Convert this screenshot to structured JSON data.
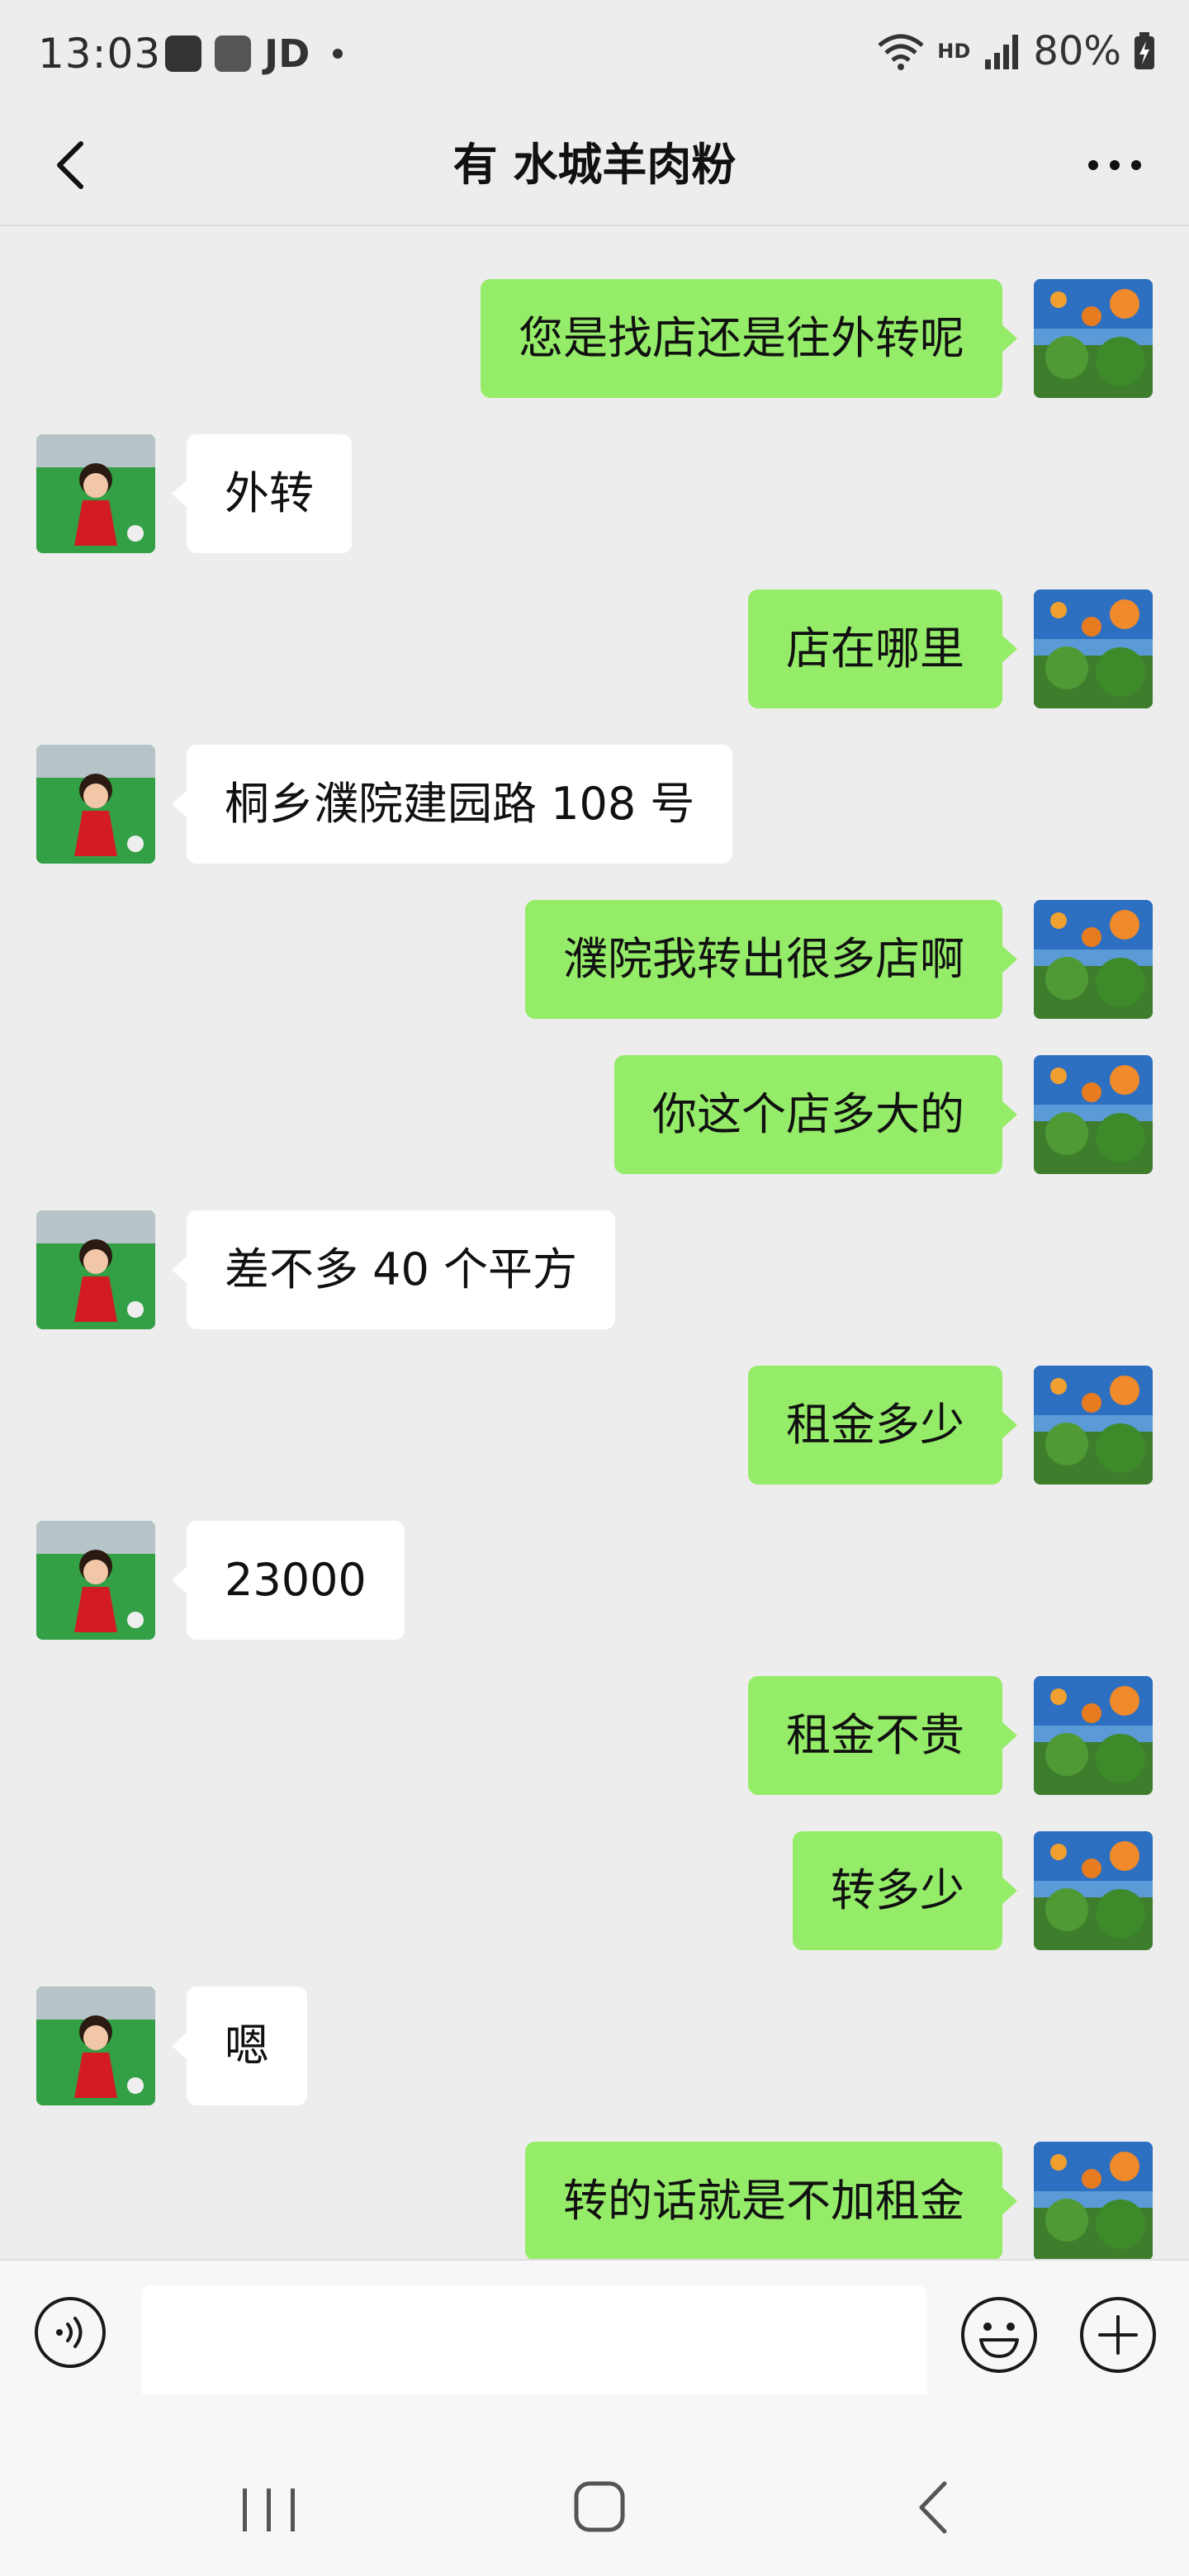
{
  "status_bar": {
    "time": "13:03",
    "carrier_text": "JD",
    "hd": "HD",
    "battery": "80%"
  },
  "header": {
    "title": "有 水城羊肉粉"
  },
  "messages": [
    {
      "from": "me",
      "text": "您是找店还是往外转呢"
    },
    {
      "from": "other",
      "text": "外转"
    },
    {
      "from": "me",
      "text": "店在哪里"
    },
    {
      "from": "other",
      "text": "桐乡濮院建园路 108 号"
    },
    {
      "from": "me",
      "text": "濮院我转出很多店啊"
    },
    {
      "from": "me",
      "text": "你这个店多大的"
    },
    {
      "from": "other",
      "text": "差不多 40 个平方"
    },
    {
      "from": "me",
      "text": "租金多少"
    },
    {
      "from": "other",
      "text": "23000"
    },
    {
      "from": "me",
      "text": "租金不贵"
    },
    {
      "from": "me",
      "text": "转多少"
    },
    {
      "from": "other",
      "text": "嗯"
    },
    {
      "from": "me",
      "text": "转的话就是不加租金"
    }
  ],
  "input": {
    "value": "",
    "placeholder": ""
  },
  "icons": {
    "voice": "voice-icon",
    "emoji": "emoji-icon",
    "plus": "plus-icon"
  },
  "colors": {
    "my_bubble": "#95ec69",
    "other_bubble": "#ffffff",
    "background": "#ededed"
  }
}
